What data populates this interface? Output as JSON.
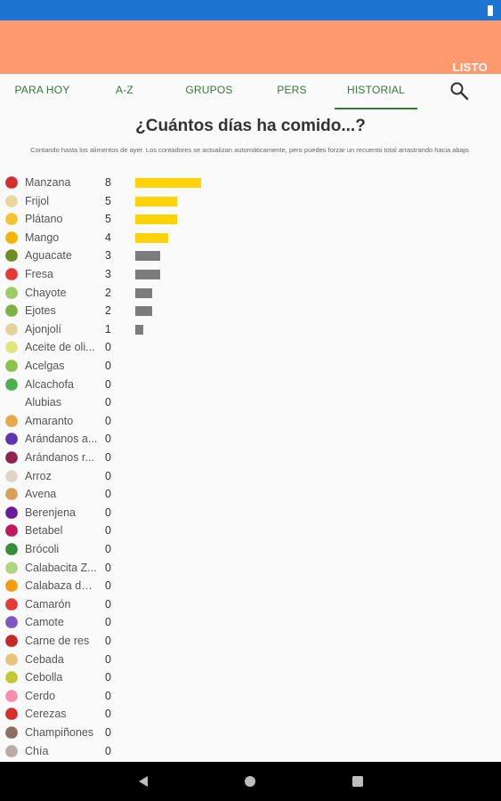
{
  "header": {
    "action_label": "LISTO"
  },
  "tabs": [
    {
      "label": "PARA HOY"
    },
    {
      "label": "A-Z"
    },
    {
      "label": "GRUPOS"
    },
    {
      "label": "PERS"
    },
    {
      "label": "HISTORIAL"
    }
  ],
  "active_tab": "HISTORIAL",
  "page": {
    "title": "¿Cuántos días ha comido...?",
    "subtitle": "Contando hasta los alimentos de ayer. Los contadores se actualizan automáticamente, pero puedes forzar un recuento total arrastrando hacia abajo."
  },
  "colors": {
    "accent_bar": "#ffd20a",
    "grey_bar": "#7c7c7c",
    "tab_text": "#2e7d32",
    "app_bar": "#ff9a6f",
    "status_bar": "#1e74d2"
  },
  "chart_data": {
    "type": "bar",
    "orientation": "horizontal",
    "categories": [
      "Manzana",
      "Frijol",
      "Plátano",
      "Mango",
      "Aguacate",
      "Fresa",
      "Chayote",
      "Ejotes",
      "Ajonjolí",
      "Aceite de oli...",
      "Acelgas",
      "Alcachofa",
      "Alubias",
      "Amaranto",
      "Arándanos a...",
      "Arándanos r...",
      "Arroz",
      "Avena",
      "Berenjena",
      "Betabel",
      "Brócoli",
      "Calabacita Z...",
      "Calabaza de ...",
      "Camarón",
      "Camote",
      "Carne de res",
      "Cebada",
      "Cebolla",
      "Cerdo",
      "Cerezas",
      "Champiñones",
      "Chía"
    ],
    "values": [
      8,
      5,
      5,
      4,
      3,
      3,
      2,
      2,
      1,
      0,
      0,
      0,
      0,
      0,
      0,
      0,
      0,
      0,
      0,
      0,
      0,
      0,
      0,
      0,
      0,
      0,
      0,
      0,
      0,
      0,
      0,
      0
    ],
    "highlighted": [
      true,
      true,
      true,
      true,
      false,
      false,
      false,
      false,
      false,
      false,
      false,
      false,
      false,
      false,
      false,
      false,
      false,
      false,
      false,
      false,
      false,
      false,
      false,
      false,
      false,
      false,
      false,
      false,
      false,
      false,
      false,
      false
    ],
    "icons": [
      "apple-icon",
      "bean-icon",
      "banana-icon",
      "mango-icon",
      "avocado-icon",
      "strawberry-icon",
      "chayote-icon",
      "green-bean-icon",
      "sesame-icon",
      "olive-oil-icon",
      "chard-icon",
      "artichoke-icon",
      "",
      "amaranth-icon",
      "blueberry-icon",
      "cranberry-icon",
      "rice-icon",
      "oats-icon",
      "eggplant-icon",
      "beet-icon",
      "broccoli-icon",
      "zucchini-icon",
      "pumpkin-icon",
      "shrimp-icon",
      "sweet-potato-icon",
      "beef-icon",
      "barley-icon",
      "onion-icon",
      "pig-icon",
      "cherry-icon",
      "mushroom-icon",
      "chia-icon"
    ],
    "icon_colors": [
      "#d32f2f",
      "#e8d7a0",
      "#f2c531",
      "#f4b400",
      "#6b8e23",
      "#e53935",
      "#9ccc65",
      "#7cb342",
      "#e6d39a",
      "#e0e67a",
      "#8bc34a",
      "#4caf50",
      "",
      "#e8a94b",
      "#5e35b1",
      "#8e244d",
      "#e0d6c8",
      "#d9a05b",
      "#6a1b9a",
      "#c2185b",
      "#388e3c",
      "#aed581",
      "#f39c12",
      "#e53935",
      "#7e57c2",
      "#c62828",
      "#e8c47a",
      "#c0ca33",
      "#f48fb1",
      "#d32f2f",
      "#8d6e63",
      "#bcaaa4"
    ]
  }
}
